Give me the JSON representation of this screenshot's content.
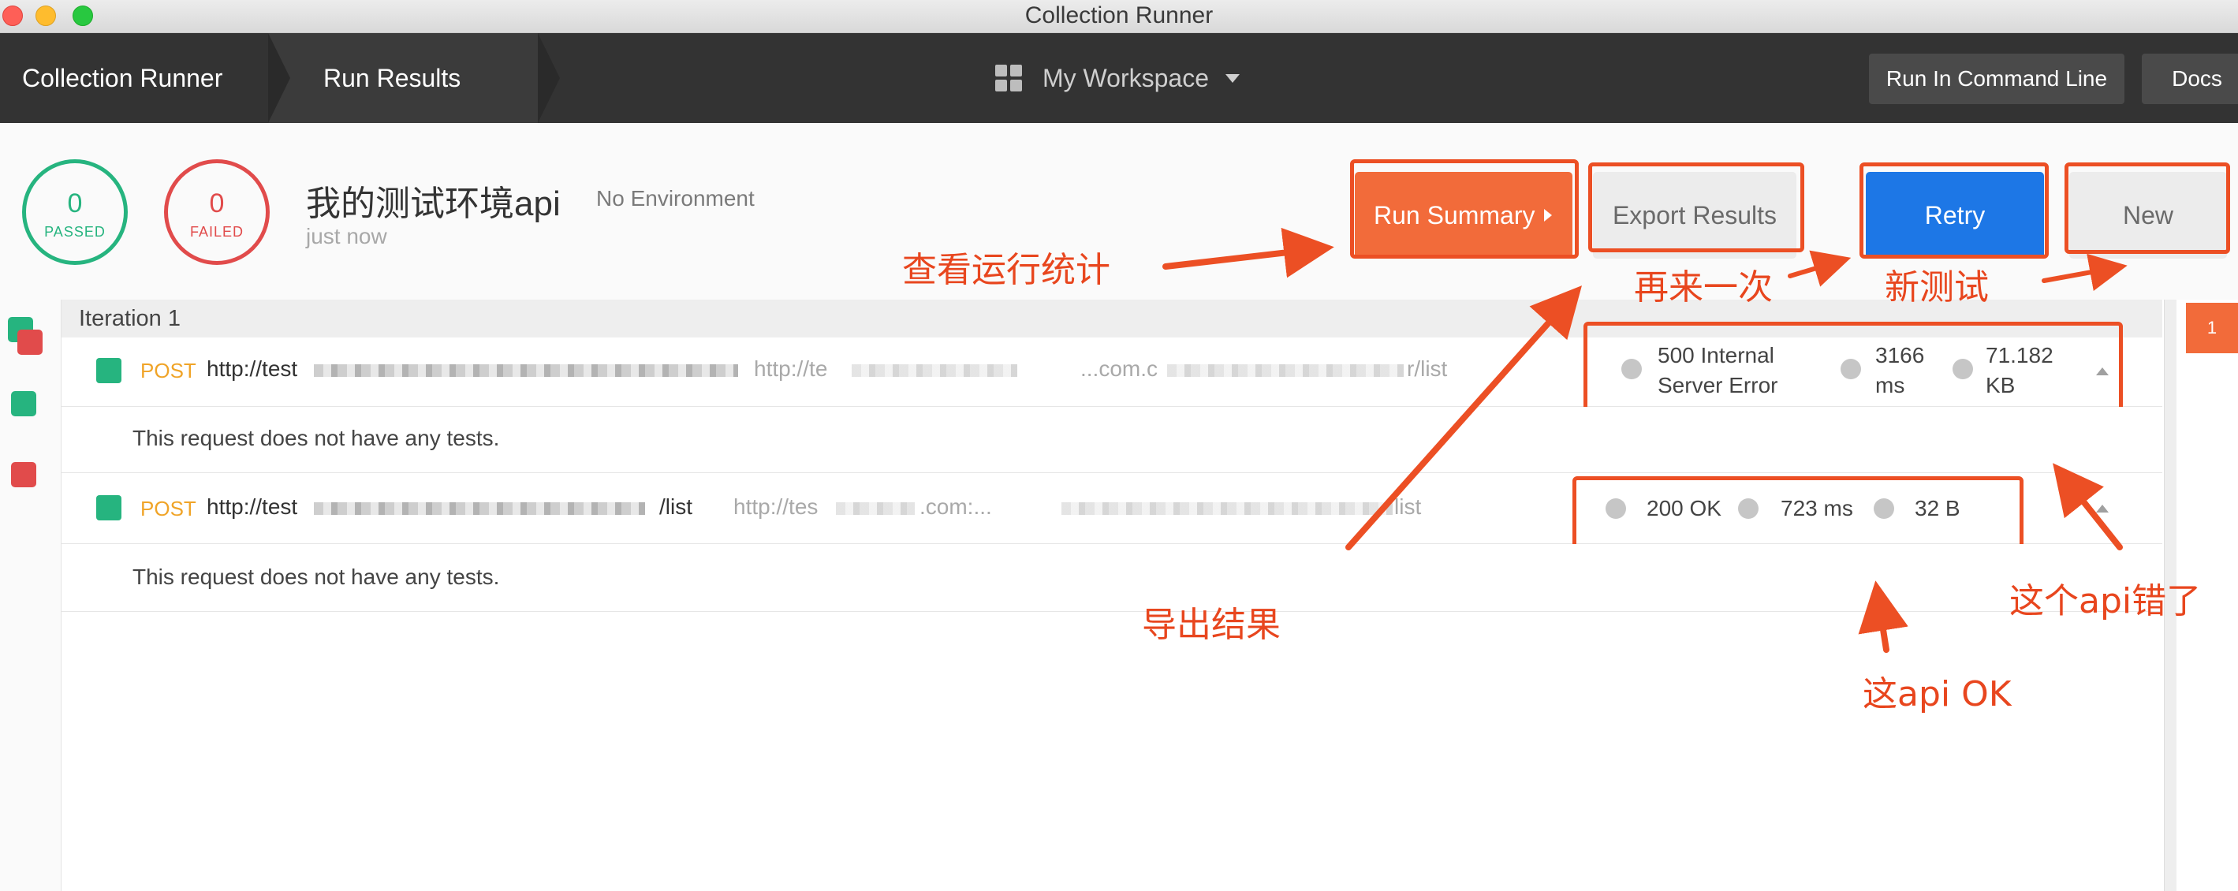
{
  "window": {
    "title": "Collection Runner"
  },
  "header": {
    "breadcrumb": [
      "Collection Runner",
      "Run Results"
    ],
    "workspace": "My Workspace",
    "run_cli_label": "Run In Command Line",
    "docs_label": "Docs"
  },
  "summary": {
    "passed_count": "0",
    "passed_label": "PASSED",
    "failed_count": "0",
    "failed_label": "FAILED",
    "collection_name": "我的测试环境api",
    "environment": "No Environment",
    "run_time": "just now",
    "buttons": {
      "run_summary": "Run Summary",
      "export_results": "Export Results",
      "retry": "Retry",
      "new": "New"
    }
  },
  "results": {
    "iteration_label": "Iteration 1",
    "badge": "1",
    "requests": [
      {
        "method": "POST",
        "url_visible": "http://test",
        "url_mid": ".com.c",
        "url_tail": "",
        "url2_visible": "http://te",
        "url2_tail": "...com.c",
        "url2_end": "r/list",
        "status": "500 Internal Server Error",
        "time": "3166 ms",
        "size": "71.182 KB",
        "note": "This request does not have any tests."
      },
      {
        "method": "POST",
        "url_visible": "http://test",
        "url_mid": "/list",
        "url_tail": "",
        "url2_visible": "http://tes",
        "url2_tail": ".com:...",
        "url2_end": "list",
        "status": "200 OK",
        "time": "723 ms",
        "size": "32 B",
        "note": "This request does not have any tests."
      }
    ]
  },
  "annotations": {
    "view_stats": "查看运行统计",
    "retry_again": "再来一次",
    "new_test": "新测试",
    "export": "导出结果",
    "api_ok": "这api OK",
    "api_error": "这个api错了"
  },
  "colors": {
    "passed": "#26b47f",
    "failed": "#e14b4b",
    "accent_orange": "#f26b3a",
    "retry_blue": "#1d77e6",
    "annotation": "#e8461e"
  }
}
